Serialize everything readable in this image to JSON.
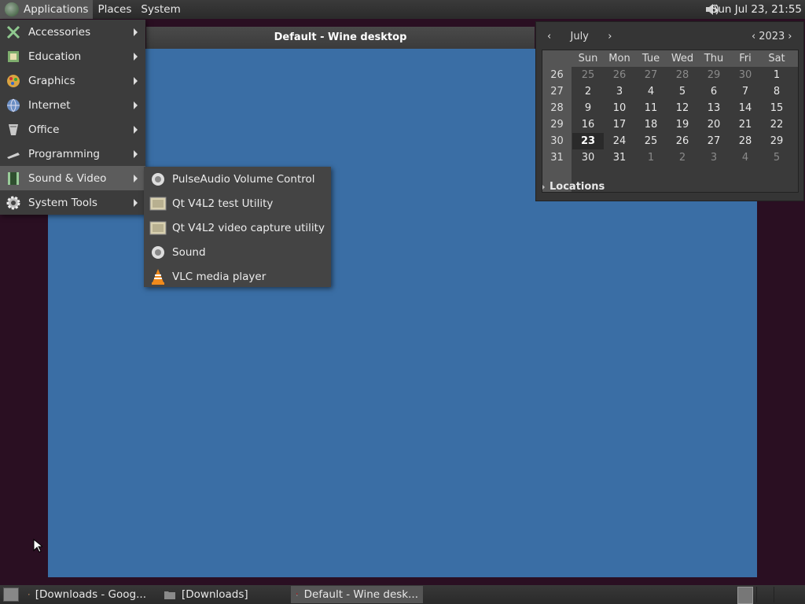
{
  "top_panel": {
    "menus": [
      "Applications",
      "Places",
      "System"
    ],
    "clock": "Sun Jul 23, 21:55"
  },
  "window": {
    "title": "Default - Wine desktop"
  },
  "app_menu": {
    "items": [
      {
        "label": "Accessories",
        "icon": "accessories-icon"
      },
      {
        "label": "Education",
        "icon": "education-icon"
      },
      {
        "label": "Graphics",
        "icon": "graphics-icon"
      },
      {
        "label": "Internet",
        "icon": "internet-icon"
      },
      {
        "label": "Office",
        "icon": "office-icon"
      },
      {
        "label": "Programming",
        "icon": "programming-icon"
      },
      {
        "label": "Sound & Video",
        "icon": "sound-video-icon"
      },
      {
        "label": "System Tools",
        "icon": "system-tools-icon"
      }
    ]
  },
  "submenu": {
    "items": [
      {
        "label": "PulseAudio Volume Control",
        "icon": "speaker-icon"
      },
      {
        "label": "Qt V4L2 test Utility",
        "icon": "video-device-icon"
      },
      {
        "label": "Qt V4L2 video capture utility",
        "icon": "video-device-icon"
      },
      {
        "label": "Sound",
        "icon": "speaker-icon"
      },
      {
        "label": "VLC media player",
        "icon": "vlc-cone-icon"
      }
    ]
  },
  "calendar": {
    "month": "July",
    "year": "2023",
    "weekdays": [
      "Sun",
      "Mon",
      "Tue",
      "Wed",
      "Thu",
      "Fri",
      "Sat"
    ],
    "weeks": [
      {
        "num": "26",
        "days": [
          "25",
          "26",
          "27",
          "28",
          "29",
          "30",
          "1"
        ]
      },
      {
        "num": "27",
        "days": [
          "2",
          "3",
          "4",
          "5",
          "6",
          "7",
          "8"
        ]
      },
      {
        "num": "28",
        "days": [
          "9",
          "10",
          "11",
          "12",
          "13",
          "14",
          "15"
        ]
      },
      {
        "num": "29",
        "days": [
          "16",
          "17",
          "18",
          "19",
          "20",
          "21",
          "22"
        ]
      },
      {
        "num": "30",
        "days": [
          "23",
          "24",
          "25",
          "26",
          "27",
          "28",
          "29"
        ]
      },
      {
        "num": "31",
        "days": [
          "30",
          "31",
          "1",
          "2",
          "3",
          "4",
          "5"
        ]
      }
    ],
    "today": "23",
    "locations_label": "Locations"
  },
  "taskbar": {
    "tasks": [
      {
        "label": "[Downloads - Goog...",
        "icon": "chrome-icon"
      },
      {
        "label": "[Downloads]",
        "icon": "folder-icon"
      },
      {
        "label": "Default - Wine desk...",
        "icon": "wine-icon"
      }
    ]
  },
  "colors": {
    "desktop_blue": "#3a6ea5",
    "panel": "#2f2f2f",
    "background": "#2a0f22"
  }
}
